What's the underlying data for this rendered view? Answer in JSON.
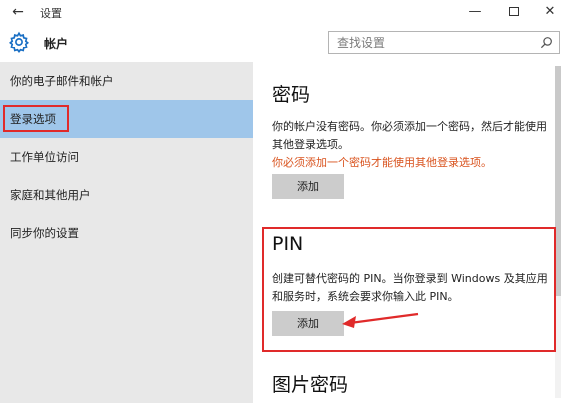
{
  "window": {
    "back_glyph": "←",
    "title": "设置",
    "minimize_glyph": "—",
    "close_glyph": "✕"
  },
  "header": {
    "app_title": "帐户",
    "search_placeholder": "查找设置"
  },
  "sidebar": {
    "items": [
      {
        "label": "你的电子邮件和帐户",
        "selected": false
      },
      {
        "label": "登录选项",
        "selected": true
      },
      {
        "label": "工作单位访问",
        "selected": false
      },
      {
        "label": "家庭和其他用户",
        "selected": false
      },
      {
        "label": "同步你的设置",
        "selected": false
      }
    ]
  },
  "password": {
    "heading": "密码",
    "description": "你的帐户没有密码。你必须添加一个密码，然后才能使用其他登录选项。",
    "warning": "你必须添加一个密码才能使用其他登录选项。",
    "add_label": "添加"
  },
  "pin": {
    "heading": "PIN",
    "description": "创建可替代密码的 PIN。当你登录到 Windows 及其应用和服务时，系统会要求你输入此 PIN。",
    "add_label": "添加"
  },
  "picture_password": {
    "heading": "图片密码"
  },
  "colors": {
    "accent_selected": "#9fc6ea",
    "highlight_red": "#e02a2a",
    "warning_text": "#d9531e"
  }
}
